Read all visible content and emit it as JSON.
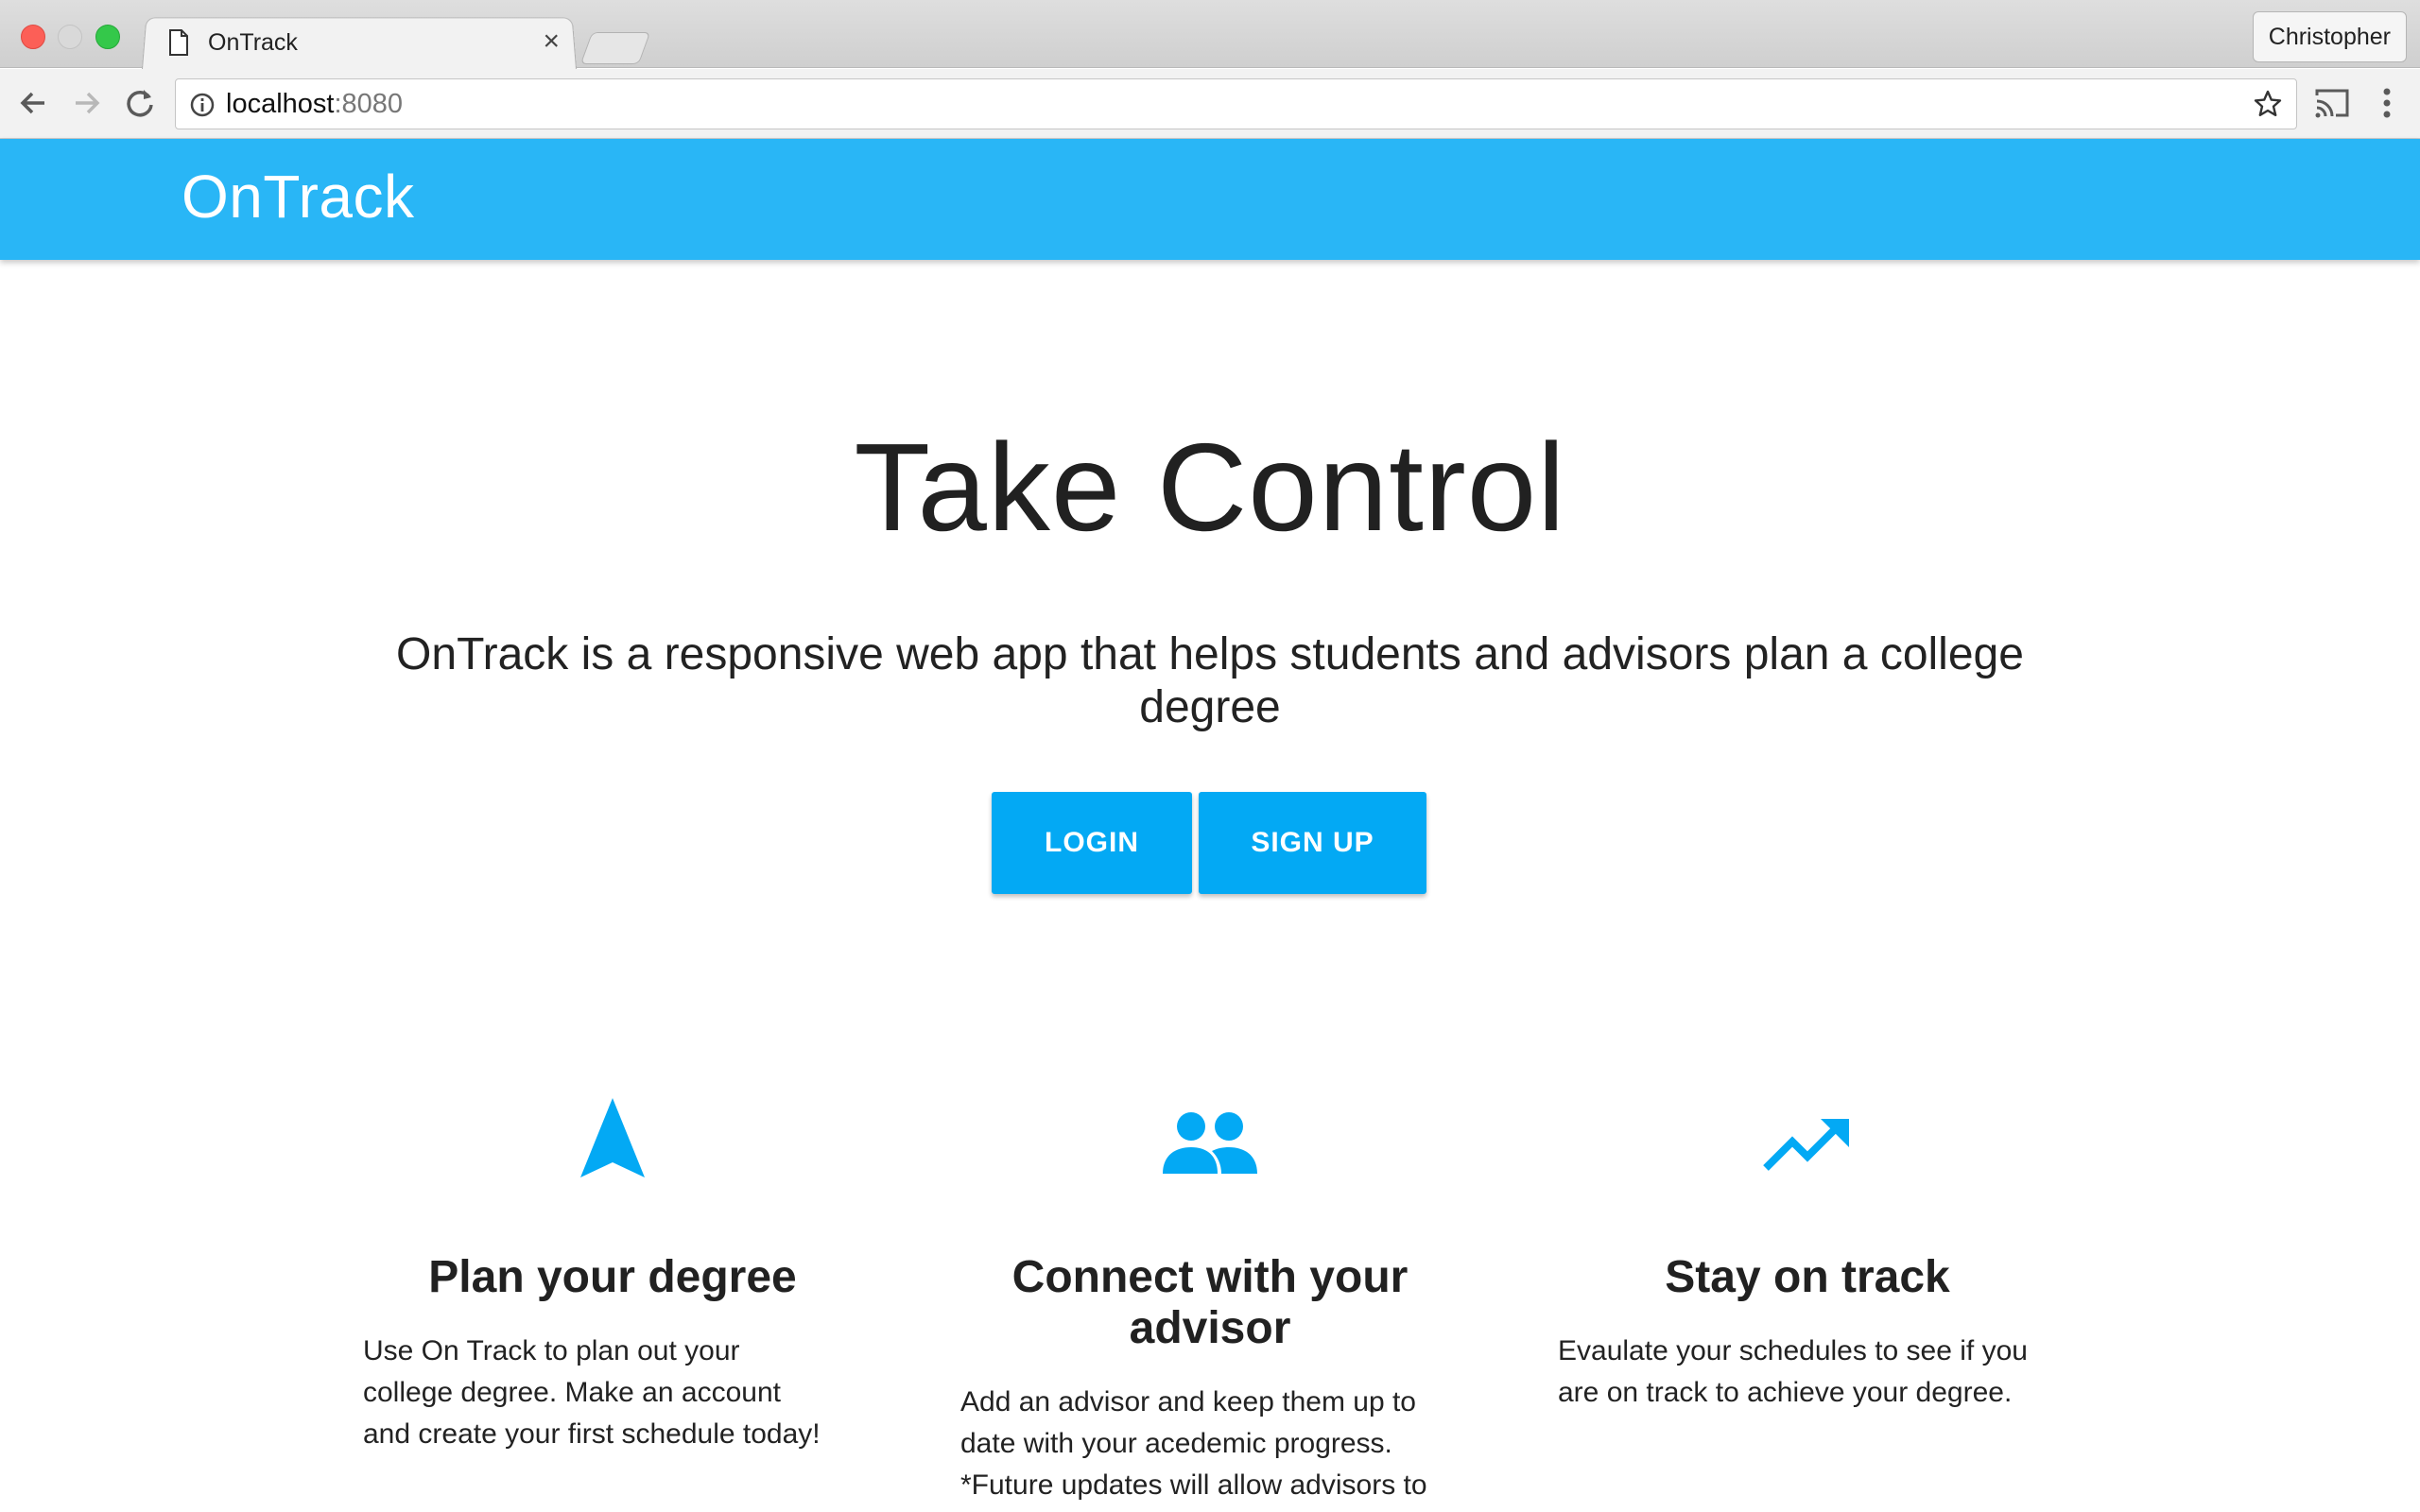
{
  "browser": {
    "tab_title": "OnTrack",
    "tab_close": "×",
    "profile_name": "Christopher",
    "url_host": "localhost",
    "url_port": ":8080"
  },
  "app": {
    "brand": "OnTrack",
    "accent_color": "#29b6f6",
    "button_color": "#03a9f4"
  },
  "hero": {
    "title": "Take Control",
    "subtitle": "OnTrack is a responsive web app that helps students and advisors plan a college degree",
    "login_label": "LOGIN",
    "signup_label": "SIGN UP"
  },
  "features": [
    {
      "icon": "navigation-arrow-icon",
      "title": "Plan your degree",
      "description": "Use On Track to plan out your college degree. Make an account and create your first schedule today!"
    },
    {
      "icon": "people-icon",
      "title": "Connect with your advisor",
      "description": "Add an advisor and keep them up to date with your acedemic progress. *Future updates will allow advisors to"
    },
    {
      "icon": "trending-up-icon",
      "title": "Stay on track",
      "description": "Evaulate your schedules to see if you are on track to achieve your degree."
    }
  ]
}
